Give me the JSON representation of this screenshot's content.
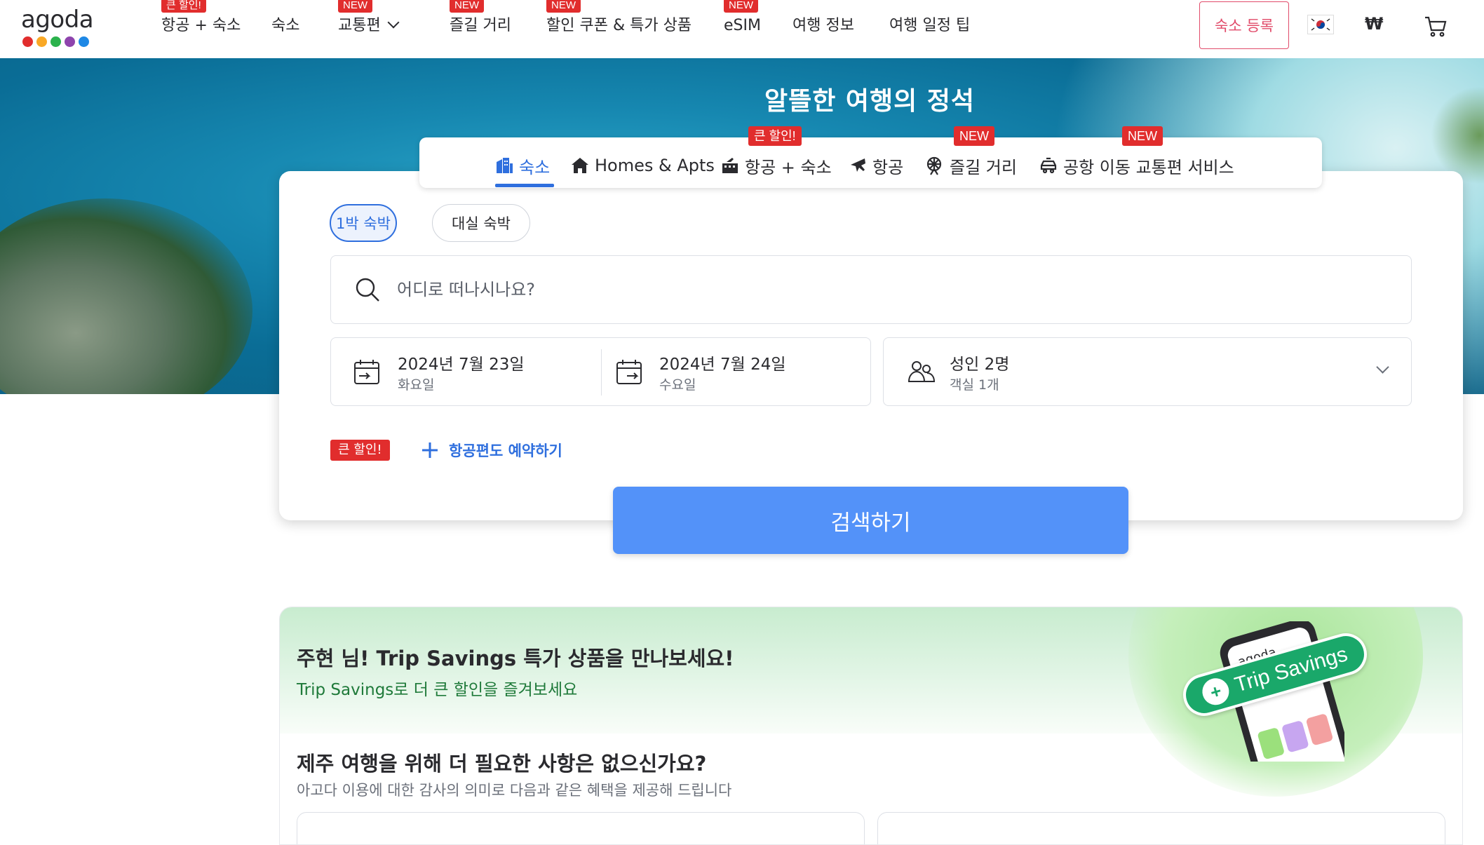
{
  "brand": {
    "name": "agoda",
    "dot_colors": [
      "#e12d2d",
      "#f9a825",
      "#2bb24c",
      "#8e44ad",
      "#1e88e5"
    ]
  },
  "topnav": {
    "items": [
      {
        "label": "항공 + 숙소",
        "badge": "큰 할인!"
      },
      {
        "label": "숙소",
        "badge": ""
      },
      {
        "label": "교통편",
        "badge": "NEW"
      },
      {
        "label": "즐길 거리",
        "badge": "NEW"
      },
      {
        "label": "할인 쿠폰 & 특가 상품",
        "badge": "NEW"
      },
      {
        "label": "eSIM",
        "badge": "NEW"
      },
      {
        "label": "여행 정보",
        "badge": ""
      },
      {
        "label": "여행 일정 팁",
        "badge": ""
      }
    ],
    "list_property": "숙소 등록",
    "currency": "₩",
    "flag_icon": "korea-flag-icon",
    "cart_icon": "cart-icon"
  },
  "hero": {
    "title": "알뜰한 여행의 정석"
  },
  "search": {
    "tabs": [
      {
        "label": "숙소",
        "icon": "hotel-icon",
        "active": true,
        "badge": ""
      },
      {
        "label": "Homes & Apts",
        "icon": "home-icon",
        "active": false,
        "badge": ""
      },
      {
        "label": "항공 + 숙소",
        "icon": "flight-hotel-icon",
        "active": false,
        "badge": "큰 할인!"
      },
      {
        "label": "항공",
        "icon": "plane-icon",
        "active": false,
        "badge": ""
      },
      {
        "label": "즐길 거리",
        "icon": "ferris-wheel-icon",
        "active": false,
        "badge": "NEW"
      },
      {
        "label": "공항 이동 교통편 서비스",
        "icon": "car-icon",
        "active": false,
        "badge": "NEW"
      }
    ],
    "stay_options": [
      "1박 숙박",
      "대실 숙박"
    ],
    "destination_placeholder": "어디로 떠나시나요?",
    "checkin": {
      "date": "2024년 7월 23일",
      "weekday": "화요일"
    },
    "checkout": {
      "date": "2024년 7월 24일",
      "weekday": "수요일"
    },
    "occupancy": {
      "guests": "성인 2명",
      "rooms": "객실 1개"
    },
    "bundle_badge": "큰 할인!",
    "add_flight": "항공편도 예약하기",
    "search_button": "검색하기",
    "accent_color": "#5392f9"
  },
  "savings": {
    "title": "주현 님! Trip Savings 특가 상품을 만나보세요!",
    "subtitle": "Trip Savings로 더 큰 할인을 즐겨보세요",
    "badge_text": "Trip Savings",
    "phone_logo": "agoda",
    "question": "제주 여행을 위해 더 필요한 사항은 없으신가요?",
    "question_sub": "아고다 이용에 대한 감사의 의미로 다음과 같은 혜택을 제공해 드립니다"
  }
}
